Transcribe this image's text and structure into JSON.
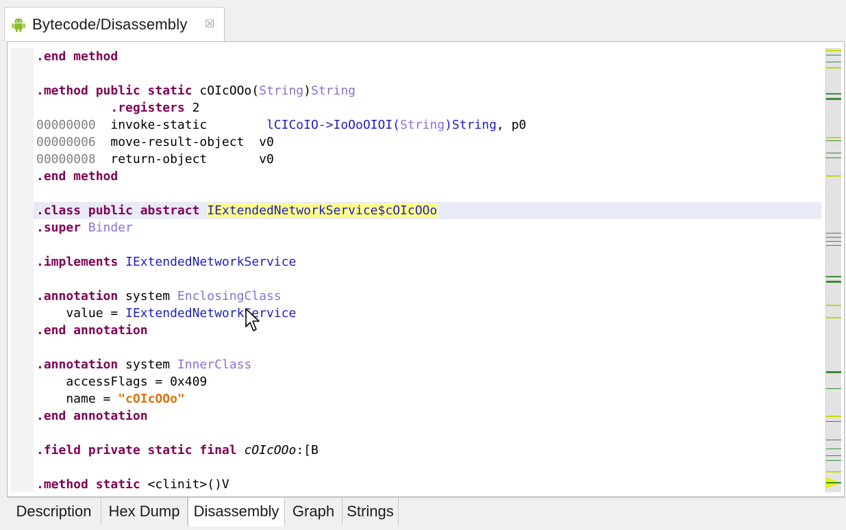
{
  "editor": {
    "tab_title": "Bytecode/Disassembly",
    "close_glyph": "☒",
    "icon": "android-icon"
  },
  "code": {
    "l1": {
      "k1": ".end method"
    },
    "l3": {
      "k1": ".method public static",
      "t1": " cOIcOOo(",
      "ty1": "String",
      "t2": ")",
      "ty2": "String"
    },
    "l4": {
      "pad": "          ",
      "k1": ".registers",
      "t1": " 2"
    },
    "l5": {
      "off": "00000000",
      "t1": "  invoke-static        ",
      "c1": "lCICoIO->IoOoOIOI(",
      "ty1": "String",
      "c2": ")String",
      "t2": ", p0"
    },
    "l6": {
      "off": "00000006",
      "t1": "  move-result-object  v0"
    },
    "l7": {
      "off": "00000008",
      "t1": "  return-object       v0"
    },
    "l8": {
      "k1": ".end method"
    },
    "l10": {
      "k1": ".class public abstract",
      "t1": " ",
      "h1": "IExtendedNetworkService$cOIcOOo"
    },
    "l11": {
      "k1": ".super",
      "t1": " ",
      "ty1": "Binder"
    },
    "l13": {
      "k1": ".implements",
      "t1": " ",
      "c1": "IExtendedNetworkService"
    },
    "l15": {
      "k1": ".annotation",
      "t1": " system ",
      "ty1": "EnclosingClass"
    },
    "l16": {
      "t1": "    value = ",
      "c1": "IExtendedNetworkService"
    },
    "l17": {
      "k1": ".end annotation"
    },
    "l19": {
      "k1": ".annotation",
      "t1": " system ",
      "ty1": "InnerClass"
    },
    "l20": {
      "t1": "    accessFlags = 0x409"
    },
    "l21": {
      "t1": "    name = ",
      "s1": "\"cOIcOOo\""
    },
    "l22": {
      "k1": ".end annotation"
    },
    "l24": {
      "k1": ".field private static final",
      "t1": " ",
      "i1": "cOIcOOo",
      "t2": ":[B"
    },
    "l26": {
      "k1": ".method static",
      "t1": " <clinit>()V"
    }
  },
  "bottom_tabs": {
    "description": "Description",
    "hex_dump": "Hex Dump",
    "disassembly": "Disassembly",
    "graph": "Graph",
    "strings": "Strings",
    "active": "Disassembly"
  },
  "colors": {
    "keyword": "#7f0055",
    "type": "#8a6fd6",
    "class_ref": "#1d1dc4",
    "string": "#e07000",
    "offset": "#808080",
    "highlight": "#ffff8c",
    "current_line": "#e8eaf6",
    "ruler_mark_yellow": "#c8d800",
    "ruler_mark_green": "#3a8a3a"
  }
}
